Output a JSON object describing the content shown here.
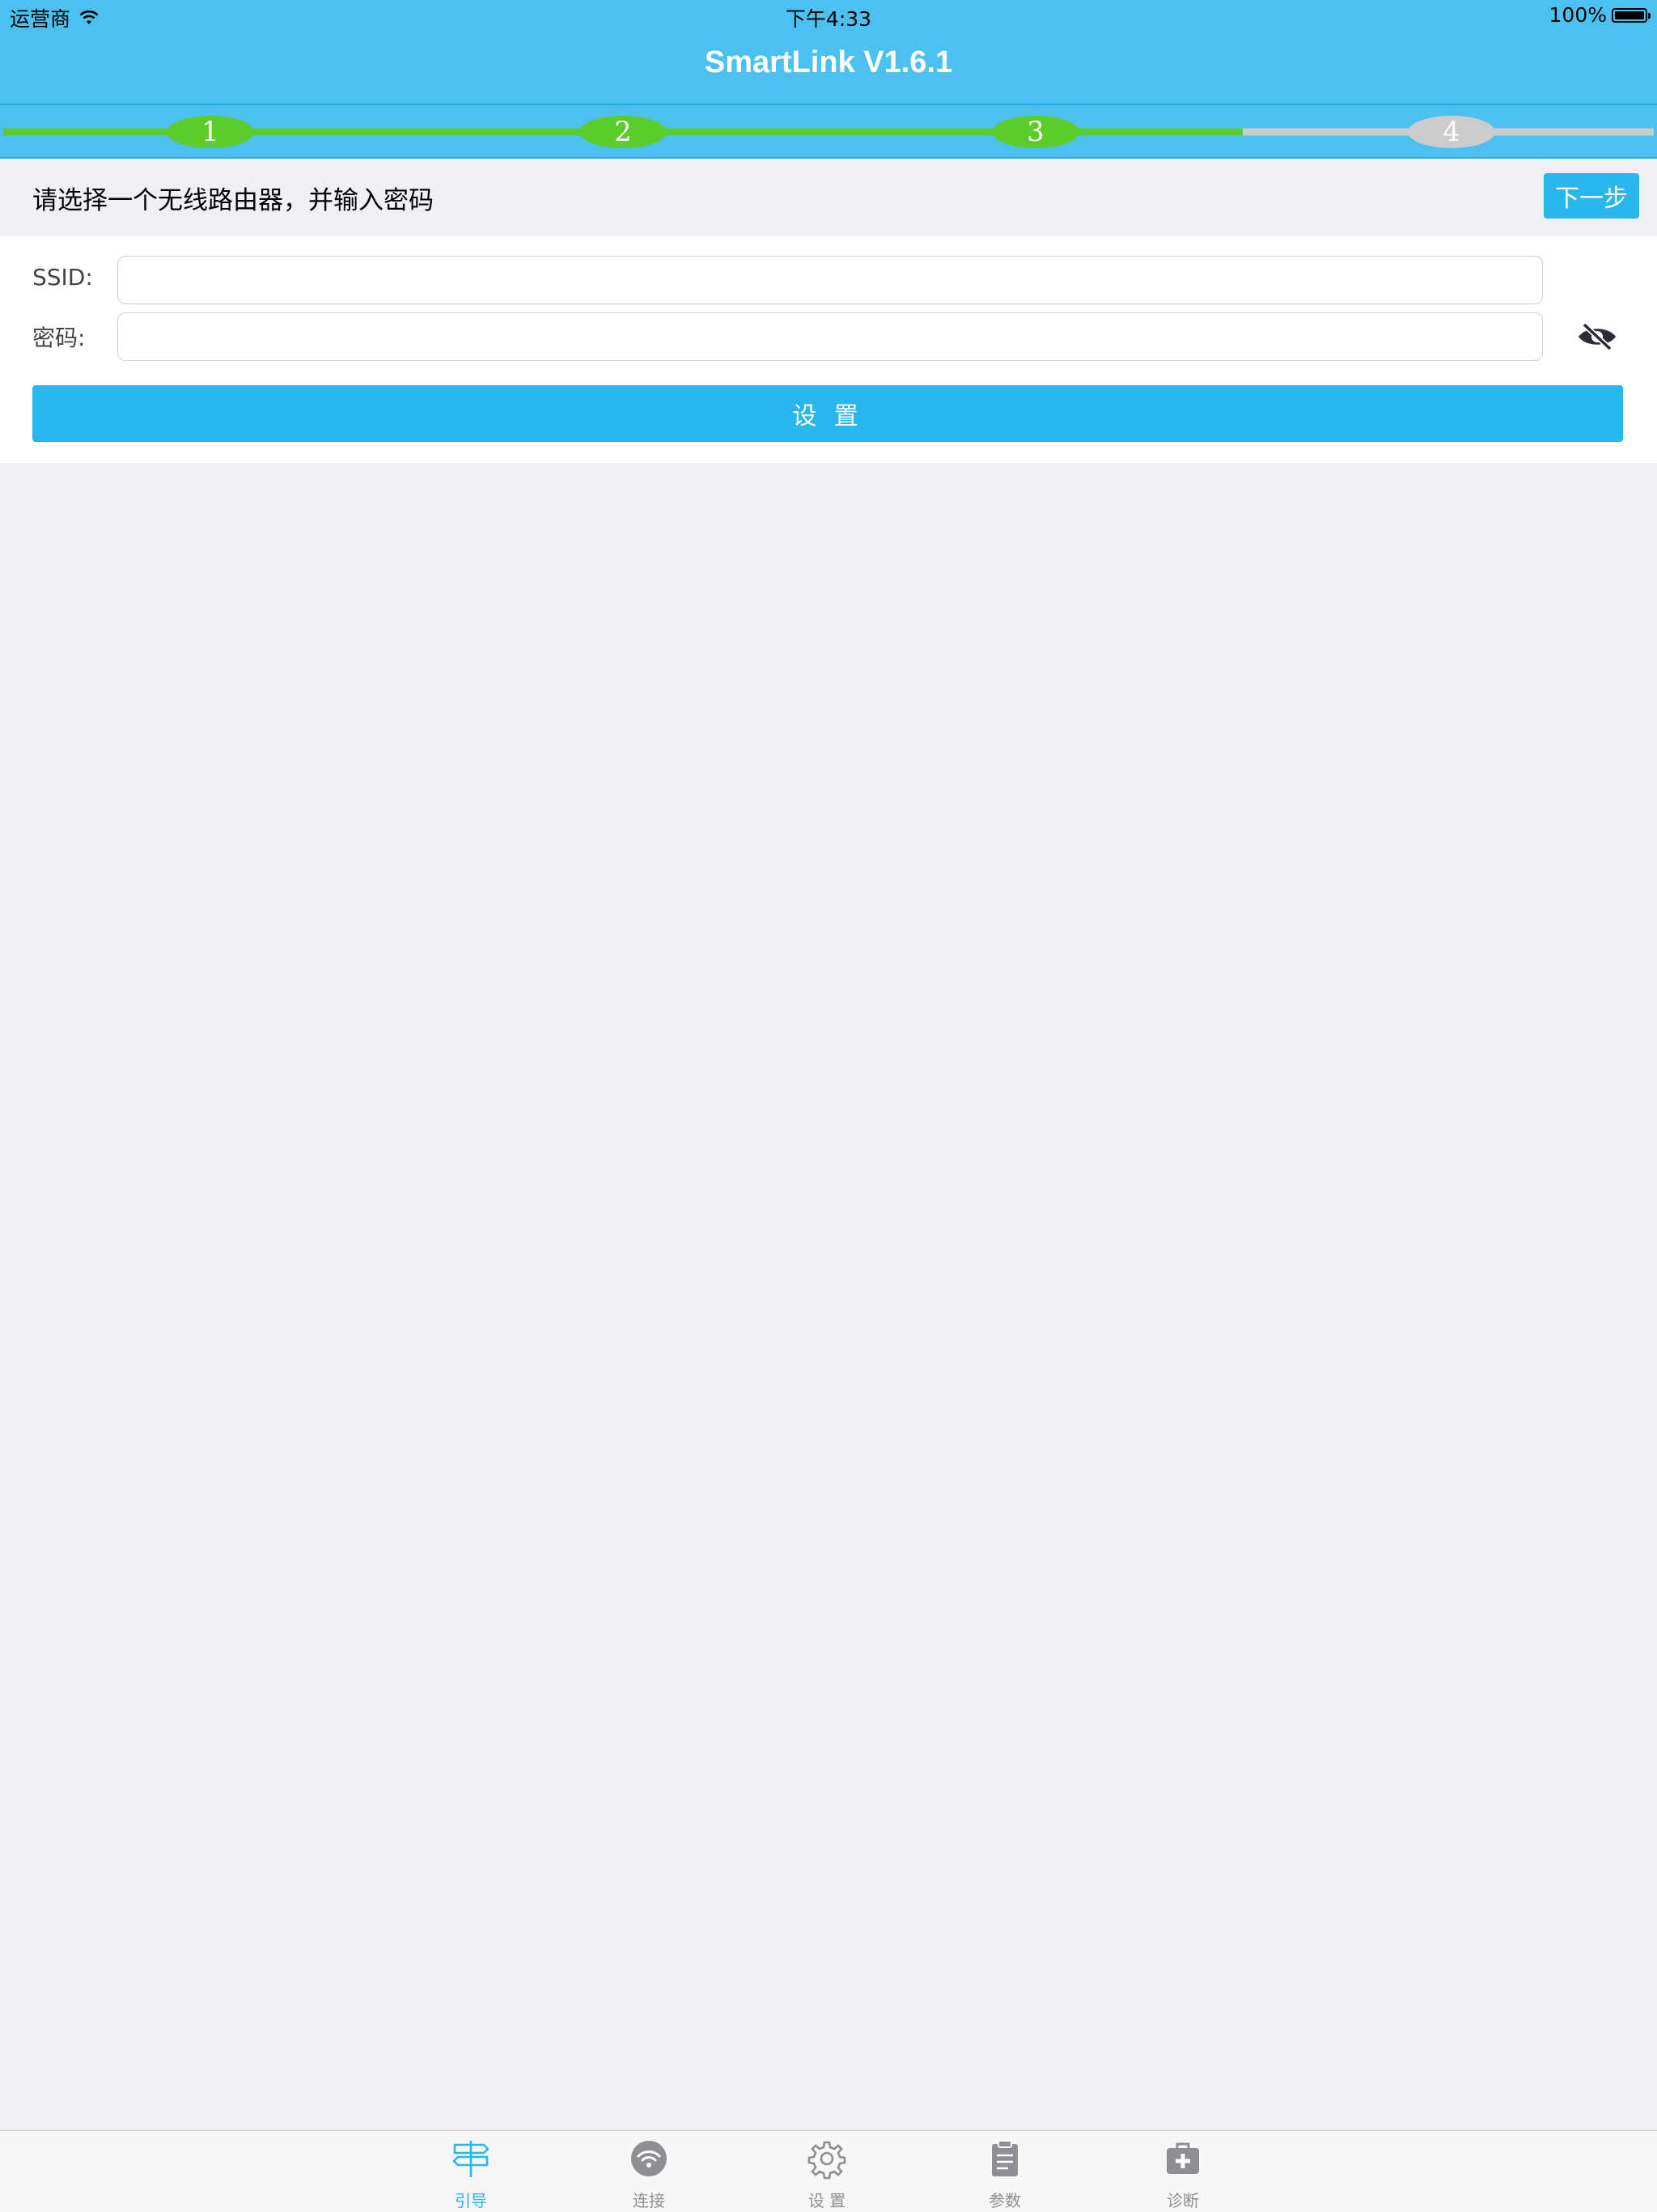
{
  "status_bar": {
    "carrier": "运营商",
    "time": "下午4:33",
    "battery": "100%"
  },
  "nav": {
    "title": "SmartLink V1.6.1"
  },
  "stepper": {
    "steps": [
      "1",
      "2",
      "3",
      "4"
    ],
    "completed_steps": 3,
    "colors": {
      "done": "#5ccc2b",
      "pending": "#cccccc"
    }
  },
  "instruction": {
    "text": "请选择一个无线路由器，并输入密码",
    "next_label": "下一步"
  },
  "form": {
    "ssid_label": "SSID:",
    "ssid_value": "",
    "password_label": "密码:",
    "password_value": "",
    "submit_label": "设 置"
  },
  "tabs": [
    {
      "label": "引导",
      "icon": "signpost-icon",
      "active": true
    },
    {
      "label": "连接",
      "icon": "wifi-icon",
      "active": false
    },
    {
      "label": "设 置",
      "icon": "gear-icon",
      "active": false
    },
    {
      "label": "参数",
      "icon": "clipboard-icon",
      "active": false
    },
    {
      "label": "诊断",
      "icon": "first-aid-kit-icon",
      "active": false
    }
  ],
  "colors": {
    "accent": "#29b6ec",
    "nav_bg": "#4cc1f0",
    "tab_inactive": "#8e8e93"
  }
}
